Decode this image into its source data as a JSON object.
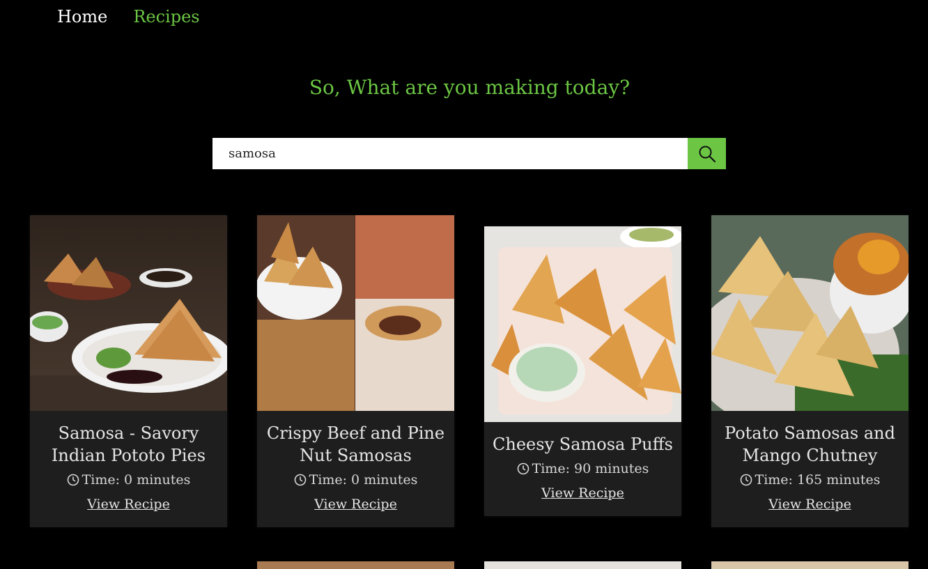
{
  "nav": {
    "home": "Home",
    "recipes": "Recipes"
  },
  "tagline": "So, What are you making today?",
  "search": {
    "value": "samosa",
    "icon": "search-icon"
  },
  "recipes": [
    {
      "title": "Samosa - Savory Indian Pototo Pies",
      "time": "Time: 0 minutes",
      "link": "View Recipe"
    },
    {
      "title": "Crispy Beef and Pine Nut Samosas",
      "time": "Time: 0 minutes",
      "link": "View Recipe"
    },
    {
      "title": "Cheesy Samosa Puffs",
      "time": "Time: 90 minutes",
      "link": "View Recipe"
    },
    {
      "title": "Potato Samosas and Mango Chutney",
      "time": "Time: 165 minutes",
      "link": "View Recipe"
    }
  ],
  "colors": {
    "accent": "#6cc644",
    "background": "#000000",
    "card": "#1e1e1e"
  }
}
